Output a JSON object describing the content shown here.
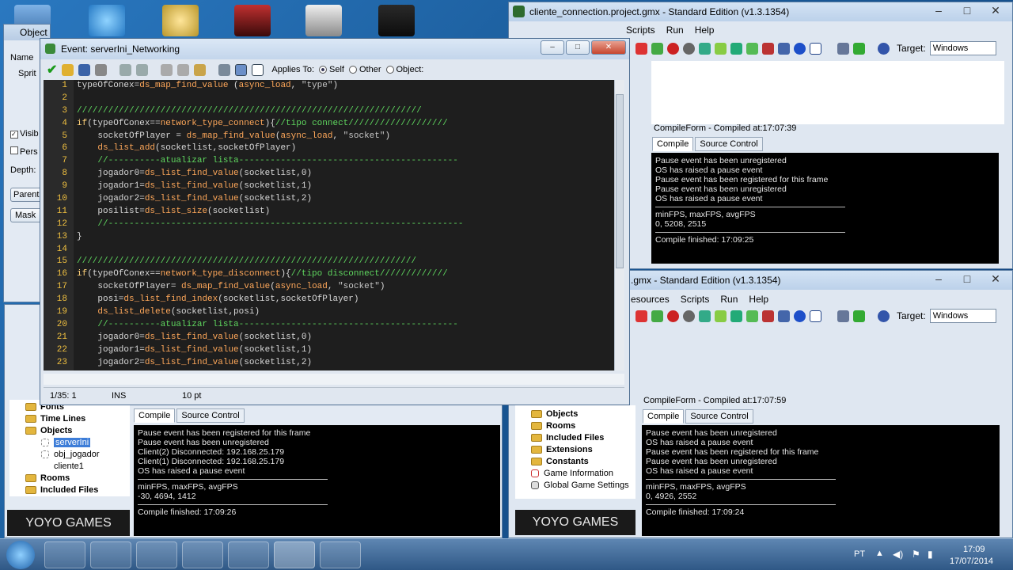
{
  "main_window": {
    "title": "cliente_connection.project.gmx - Standard Edition (v1.3.1354)",
    "menu": [
      "Scripts",
      "Run",
      "Help"
    ],
    "target_label": "Target:",
    "target_value": "Windows",
    "compile_title": "CompileForm - Compiled at:17:07:39",
    "tabs": [
      "Compile",
      "Source Control"
    ],
    "console": [
      "Pause event has been unregistered",
      "OS has raised a pause event",
      "Pause event has been registered for this frame",
      "Pause event has been unregistered",
      "OS has raised a pause event"
    ],
    "stats_label": "minFPS, maxFPS, avgFPS",
    "stats_value": "0, 5208, 2515",
    "finished": "Compile finished: 17:09:25"
  },
  "second_window": {
    "title": ".gmx - Standard Edition (v1.3.1354)",
    "menu": [
      "esources",
      "Scripts",
      "Run",
      "Help"
    ],
    "target_label": "Target:",
    "target_value": "Windows",
    "compile_title": "CompileForm - Compiled at:17:07:59",
    "tabs": [
      "Compile",
      "Source Control"
    ],
    "console": [
      "Pause event has been unregistered",
      "OS has raised a pause event",
      "Pause event has been registered for this frame",
      "Pause event has been unregistered",
      "OS has raised a pause event"
    ],
    "stats_label": "minFPS, maxFPS, avgFPS",
    "stats_value": "0, 4926, 2552",
    "finished": "Compile finished: 17:09:24",
    "tree": [
      "Objects",
      "Rooms",
      "Included Files",
      "Extensions",
      "Constants",
      "Game Information",
      "Global Game Settings"
    ]
  },
  "left_window": {
    "tree": [
      "Fonts",
      "Time Lines",
      "Objects",
      "serverIni",
      "obj_jogador",
      "cliente1",
      "Rooms",
      "Included Files"
    ],
    "tabs": [
      "Compile",
      "Source Control"
    ],
    "console": [
      "Pause event has been registered for this frame",
      "Pause event has been unregistered",
      "Client(2) Disconnected: 192.168.25.179",
      "Client(1) Disconnected: 192.168.25.179",
      "OS has raised a pause event"
    ],
    "stats_label": "minFPS, maxFPS, avgFPS",
    "stats_value": "-30, 4694, 1412",
    "finished": "Compile finished: 17:09:26"
  },
  "object_props": {
    "title": "Object Properties: serverIni",
    "labels": [
      "Name",
      "Sprit",
      "Visib",
      "Pers",
      "Depth:",
      "Parent",
      "Mask"
    ]
  },
  "event_window": {
    "title": "Event: serverIni_Networking",
    "applies_to": "Applies To:",
    "options": [
      "Self",
      "Other",
      "Object:"
    ],
    "status_pos": "1/35:  1",
    "status_mode": "INS",
    "status_font": "10 pt",
    "code_lines": [
      "typeOfConex=ds_map_find_value (async_load, \"type\")",
      "",
      "//////////////////////////////////////////////////////////////////",
      "if(typeOfConex==network_type_connect){//tipo connect///////////////////",
      "    socketOfPlayer = ds_map_find_value(async_load, \"socket\")",
      "    ds_list_add(socketlist,socketOfPlayer)",
      "    //----------atualizar lista------------------------------------------",
      "    jogador0=ds_list_find_value(socketlist,0)",
      "    jogador1=ds_list_find_value(socketlist,1)",
      "    jogador2=ds_list_find_value(socketlist,2)",
      "    posilist=ds_list_size(socketlist)",
      "    //--------------------------------------------------------------------",
      "}",
      "",
      "/////////////////////////////////////////////////////////////////",
      "if(typeOfConex==network_type_disconnect){//tipo disconnect/////////////",
      "    socketOfPlayer= ds_map_find_value(async_load, \"socket\")",
      "    posi=ds_list_find_index(socketlist,socketOfPlayer)",
      "    ds_list_delete(socketlist,posi)",
      "    //----------atualizar lista------------------------------------------",
      "    jogador0=ds_list_find_value(socketlist,0)",
      "    jogador1=ds_list_find_value(socketlist,1)",
      "    jogador2=ds_list_find_value(socketlist,2)"
    ],
    "line_numbers": [
      "1",
      "2",
      "3",
      "4",
      "5",
      "6",
      "7",
      "8",
      "9",
      "10",
      "11",
      "12",
      "13",
      "14",
      "15",
      "16",
      "17",
      "18",
      "19",
      "20",
      "21",
      "22",
      "23"
    ]
  },
  "brand": {
    "logo_text": "YOYO GAMES"
  },
  "taskbar": {
    "lang": "PT",
    "time": "17:09",
    "date": "17/07/2014"
  },
  "colors": {
    "code_bg": "#1e1e1e",
    "keyword": "#ffd27a",
    "comment": "#5fd75f"
  }
}
